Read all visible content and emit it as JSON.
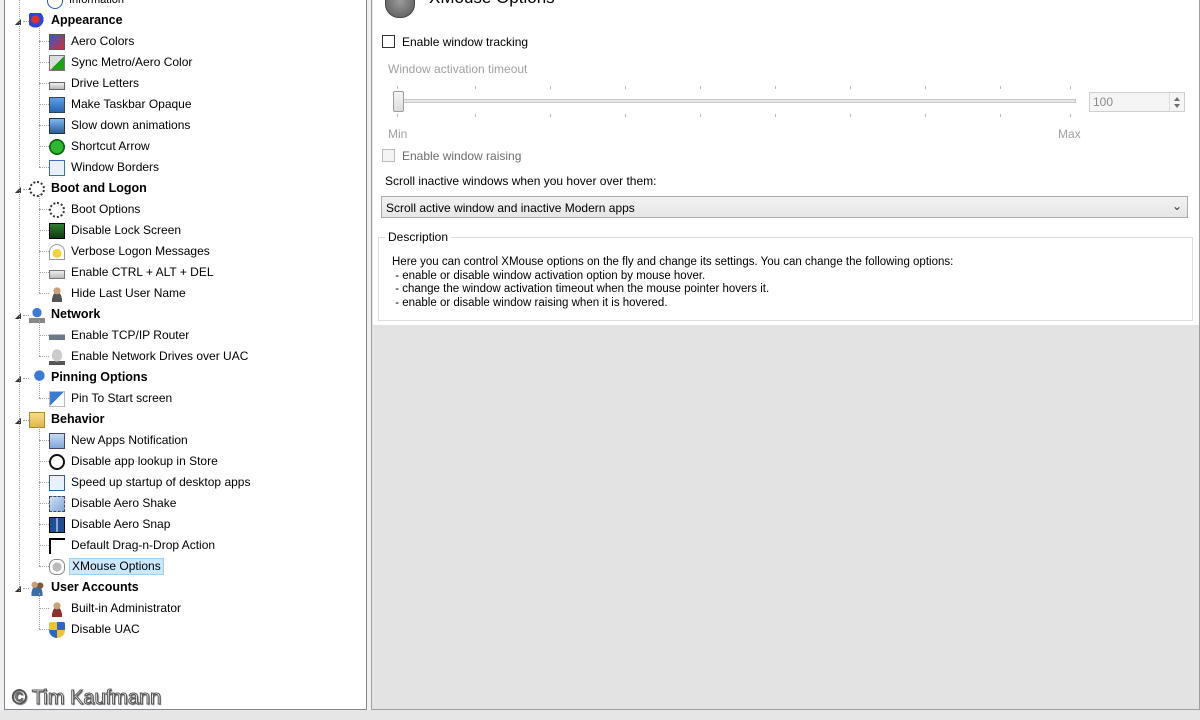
{
  "tree": {
    "top_partial_item": "Information",
    "categories": [
      {
        "label": "Appearance",
        "icon": "palette-icon",
        "items": [
          {
            "label": "Aero Colors",
            "icon": "aero-colors-icon"
          },
          {
            "label": "Sync Metro/Aero Color",
            "icon": "sync-color-icon"
          },
          {
            "label": "Drive Letters",
            "icon": "drive-icon"
          },
          {
            "label": "Make Taskbar Opaque",
            "icon": "taskbar-icon"
          },
          {
            "label": "Slow down animations",
            "icon": "animation-icon"
          },
          {
            "label": "Shortcut Arrow",
            "icon": "shortcut-arrow-icon"
          },
          {
            "label": "Window Borders",
            "icon": "window-borders-icon"
          }
        ]
      },
      {
        "label": "Boot and Logon",
        "icon": "boot-spinner-icon",
        "items": [
          {
            "label": "Boot Options",
            "icon": "boot-spinner-icon"
          },
          {
            "label": "Disable Lock Screen",
            "icon": "lock-screen-icon"
          },
          {
            "label": "Verbose Logon Messages",
            "icon": "warning-message-icon"
          },
          {
            "label": "Enable CTRL + ALT + DEL",
            "icon": "keyboard-icon"
          },
          {
            "label": "Hide Last User Name",
            "icon": "user-icon"
          }
        ]
      },
      {
        "label": "Network",
        "icon": "network-icon",
        "items": [
          {
            "label": "Enable TCP/IP Router",
            "icon": "router-icon"
          },
          {
            "label": "Enable Network Drives over UAC",
            "icon": "network-drive-icon"
          }
        ]
      },
      {
        "label": "Pinning Options",
        "icon": "pin-icon",
        "items": [
          {
            "label": "Pin To Start screen",
            "icon": "pin-start-icon"
          }
        ]
      },
      {
        "label": "Behavior",
        "icon": "behavior-folder-icon",
        "items": [
          {
            "label": "New Apps Notification",
            "icon": "notification-icon"
          },
          {
            "label": "Disable app lookup in Store",
            "icon": "store-icon"
          },
          {
            "label": "Speed up startup of desktop apps",
            "icon": "startup-icon"
          },
          {
            "label": "Disable Aero Shake",
            "icon": "aero-shake-icon"
          },
          {
            "label": "Disable Aero Snap",
            "icon": "aero-snap-icon"
          },
          {
            "label": "Default Drag-n-Drop Action",
            "icon": "cursor-icon"
          },
          {
            "label": "XMouse Options",
            "icon": "mouse-icon",
            "selected": true
          }
        ]
      },
      {
        "label": "User Accounts",
        "icon": "users-icon",
        "items": [
          {
            "label": "Built-in Administrator",
            "icon": "admin-user-icon"
          },
          {
            "label": "Disable UAC",
            "icon": "uac-shield-icon"
          }
        ]
      }
    ]
  },
  "panel": {
    "title": "XMouse Options",
    "enable_tracking_label": "Enable window tracking",
    "enable_tracking_checked": false,
    "timeout_label": "Window activation timeout",
    "slider_min_label": "Min",
    "slider_max_label": "Max",
    "timeout_value": "100",
    "enable_raising_label": "Enable window raising",
    "enable_raising_checked": false,
    "scroll_label": "Scroll inactive windows when you hover over them:",
    "scroll_selected": "Scroll active window and inactive Modern apps",
    "description_legend": "Description",
    "description_lines": [
      "Here you can control XMouse options on the fly and change its settings. You can change the following options:",
      " - enable or disable window activation option by mouse hover.",
      " - change the window activation timeout when the mouse pointer hovers it.",
      " - enable or disable window raising when it is hovered."
    ]
  },
  "watermark": "© Tim Kaufmann"
}
